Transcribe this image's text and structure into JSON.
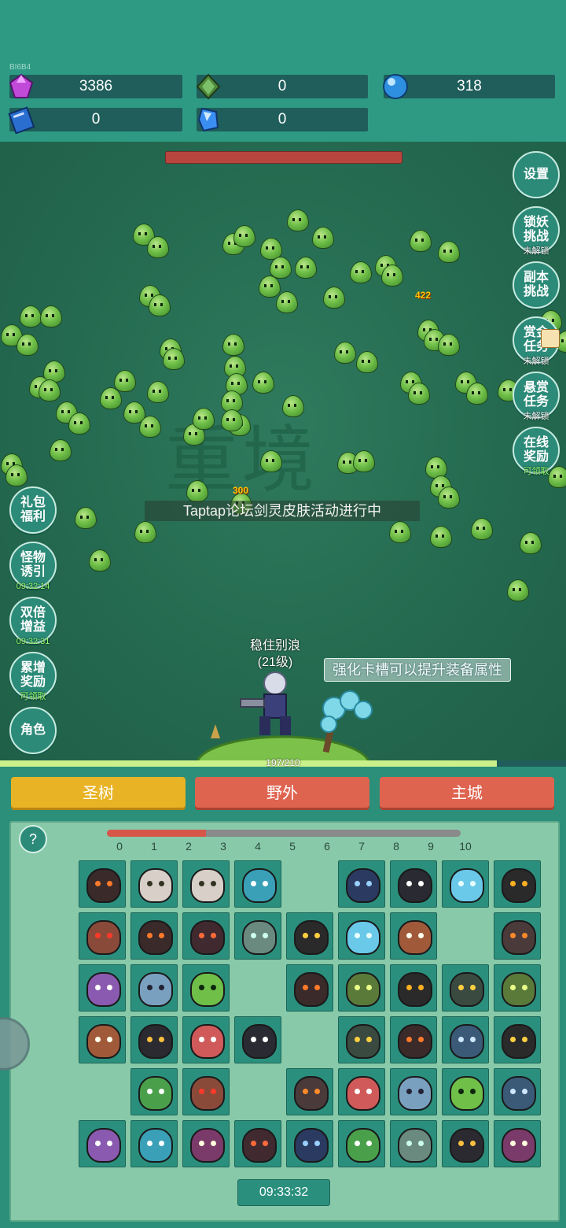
{
  "topbar": {
    "tiny_id": "BI6B4",
    "resources": [
      {
        "name": "gem",
        "value": "3386",
        "icon": "purple-gem-icon"
      },
      {
        "name": "green_stone",
        "value": "0",
        "icon": "green-stone-icon"
      },
      {
        "name": "orb",
        "value": "318",
        "icon": "blue-orb-icon"
      },
      {
        "name": "book",
        "value": "0",
        "icon": "blue-book-icon"
      },
      {
        "name": "crystal",
        "value": "0",
        "icon": "blue-crystal-icon"
      }
    ]
  },
  "field": {
    "watermark": "重境",
    "announcement": "Taptap论坛剑灵皮肤活动进行中",
    "damage_numbers": [
      "422",
      "300"
    ],
    "hero": {
      "name": "稳住别浪",
      "level": "(21级)"
    },
    "tip": "强化卡槽可以提升装备属性",
    "boss_hp": 1.0,
    "xp": {
      "text": "197/210",
      "fraction": 0.9381
    }
  },
  "right_buttons": [
    {
      "id": "settings",
      "label": "设置",
      "sub": ""
    },
    {
      "id": "lock-demon",
      "label": "锁妖\n挑战",
      "sub": "未解锁"
    },
    {
      "id": "dungeon",
      "label": "副本\n挑战",
      "sub": ""
    },
    {
      "id": "bounty-gold",
      "label": "赏金\n任务",
      "sub": "未解锁"
    },
    {
      "id": "bounty-reward",
      "label": "悬赏\n任务",
      "sub": "未解锁"
    },
    {
      "id": "online-reward",
      "label": "在线\n奖励",
      "sub": "可领取"
    }
  ],
  "left_buttons": [
    {
      "id": "gift",
      "label": "礼包\n福利",
      "sub": ""
    },
    {
      "id": "lure",
      "label": "怪物\n诱引",
      "sub": "09:32:14"
    },
    {
      "id": "double",
      "label": "双倍\n增益",
      "sub": "09:32:31"
    },
    {
      "id": "accum",
      "label": "累增\n奖励",
      "sub": "可领取"
    },
    {
      "id": "role",
      "label": "角色",
      "sub": ""
    }
  ],
  "tabs": {
    "tree": "圣树",
    "field": "野外",
    "city": "主城"
  },
  "panel": {
    "help": "?",
    "level_progress": 0.28,
    "ticks": [
      "0",
      "1",
      "2",
      "3",
      "4",
      "5",
      "6",
      "7",
      "8",
      "9",
      "10"
    ],
    "timer": "09:33:32",
    "grid": [
      [
        "lava",
        "bear",
        "bear",
        "squid",
        "",
        "alien",
        "bomb",
        "ice",
        "spider"
      ],
      [
        "robot",
        "lava",
        "crab",
        "jelly",
        "mine",
        "ice",
        "bug",
        "",
        "tank"
      ],
      [
        "bat",
        "yeti",
        "slime",
        "",
        "lava",
        "tree",
        "spider",
        "skull",
        "tree"
      ],
      [
        "bug",
        "rock",
        "bird",
        "bomb",
        "",
        "skull",
        "lava",
        "wolf",
        "mine"
      ],
      [
        "",
        "mantis",
        "robot",
        "",
        "tank",
        "bird",
        "yeti",
        "slime",
        "wolf"
      ],
      [
        "bat",
        "squid",
        "urchin",
        "crab",
        "alien",
        "mantis",
        "jelly",
        "rock",
        "urchin"
      ]
    ]
  },
  "colors": {
    "accent_gold": "#e8b325",
    "accent_red": "#de6450",
    "teal": "#2b8f7e"
  }
}
